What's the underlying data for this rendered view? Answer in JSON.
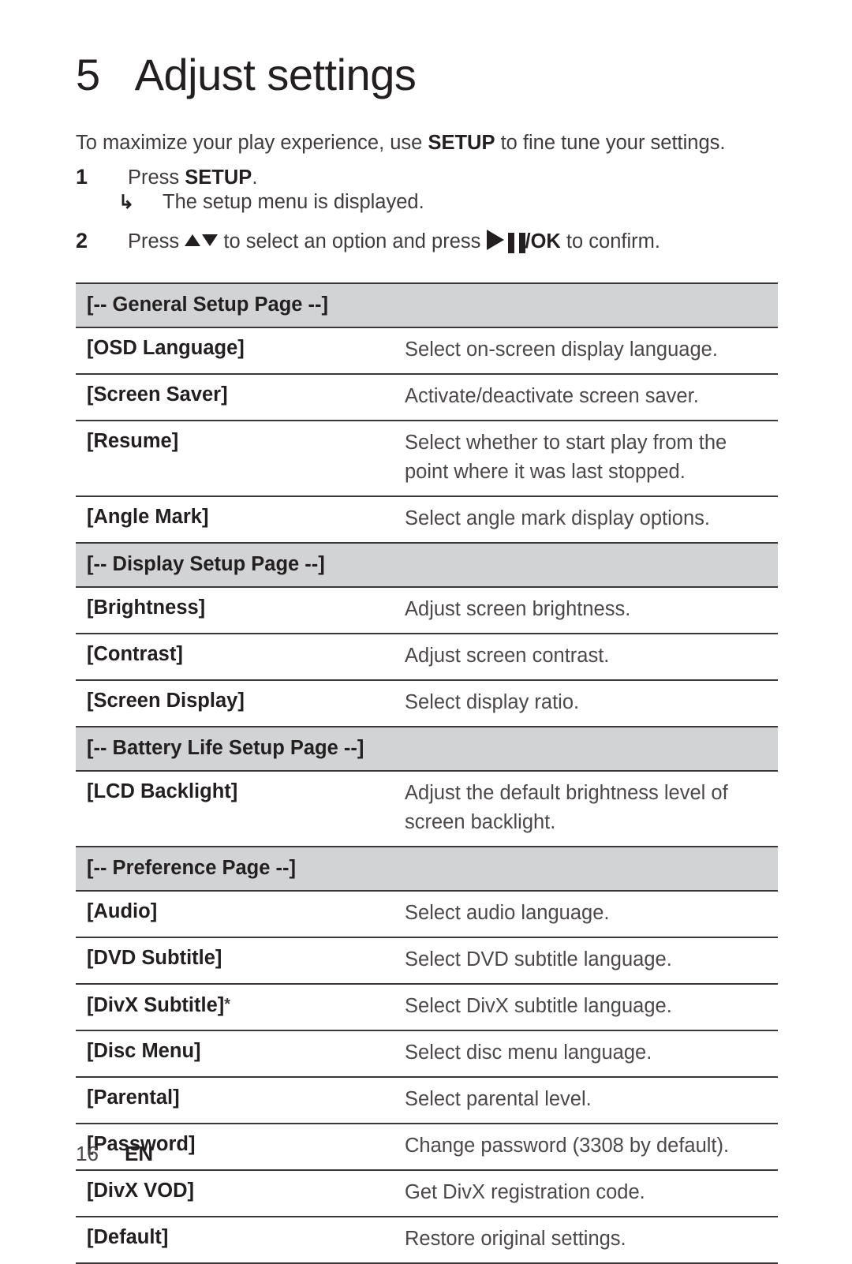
{
  "chapter": {
    "number": "5",
    "title": "Adjust settings"
  },
  "intro": {
    "before": "To maximize your play experience, use ",
    "emphasis": "SETUP",
    "after": " to fine tune your settings."
  },
  "steps": [
    {
      "number": "1",
      "text_before": "Press ",
      "emphasis": "SETUP",
      "text_after": ".",
      "result_arrow": "↳",
      "result": "The setup menu is displayed."
    },
    {
      "number": "2",
      "text_before": "Press ",
      "updown_icon": "up-down-arrows-icon",
      "text_middle": " to select an option and press ",
      "play_icon": "play-icon",
      "pause_icon": "pause-icon",
      "ok_label": "/OK",
      "text_after": " to confirm."
    }
  ],
  "table": {
    "rows": [
      {
        "type": "header",
        "label": "[-- General Setup Page --]",
        "desc": ""
      },
      {
        "type": "item",
        "label": "[OSD Language]",
        "desc": "Select on-screen display language."
      },
      {
        "type": "item",
        "label": "[Screen Saver]",
        "desc": "Activate/deactivate screen saver."
      },
      {
        "type": "item",
        "label": "[Resume]",
        "desc": "Select whether to start play from the",
        "desc2": "point where it was last stopped."
      },
      {
        "type": "item",
        "label": "[Angle Mark]",
        "desc": "Select angle mark display options."
      },
      {
        "type": "header",
        "label": "[-- Display Setup Page --]",
        "desc": ""
      },
      {
        "type": "item",
        "label": "[Brightness]",
        "desc": "Adjust screen brightness."
      },
      {
        "type": "item",
        "label": "[Contrast]",
        "desc": "Adjust screen contrast."
      },
      {
        "type": "item",
        "label": "[Screen Display]",
        "desc": "Select display ratio."
      },
      {
        "type": "header",
        "label": "[-- Battery Life Setup Page --]",
        "desc": ""
      },
      {
        "type": "item",
        "label": "[LCD Backlight]",
        "desc": "Adjust the default brightness level of",
        "desc2": "screen backlight."
      },
      {
        "type": "header",
        "label": "[-- Preference Page --]",
        "desc": ""
      },
      {
        "type": "item",
        "label": "[Audio]",
        "desc": "Select audio language."
      },
      {
        "type": "item",
        "label": "[DVD Subtitle]",
        "desc": "Select DVD subtitle language."
      },
      {
        "type": "item",
        "label": "[DivX Subtitle]",
        "marker": "*",
        "desc": "Select DivX subtitle language."
      },
      {
        "type": "item",
        "label": "[Disc Menu]",
        "desc": "Select disc menu language."
      },
      {
        "type": "item",
        "label": "[Parental]",
        "desc": "Select parental level."
      },
      {
        "type": "item",
        "label": "[Password]",
        "desc": "Change password (3308 by default)."
      },
      {
        "type": "item",
        "label": "[DivX VOD]",
        "desc": "Get DivX registration code."
      },
      {
        "type": "item",
        "label": "[Default]",
        "desc": "Restore original settings."
      }
    ]
  },
  "footer": {
    "page_number": "16",
    "language": "EN"
  },
  "colors": {
    "header_background": "#d2d3d5",
    "rule": "#3b3739",
    "text": "#231f20",
    "description_text": "#4c4849",
    "page_background": "#ffffff"
  }
}
